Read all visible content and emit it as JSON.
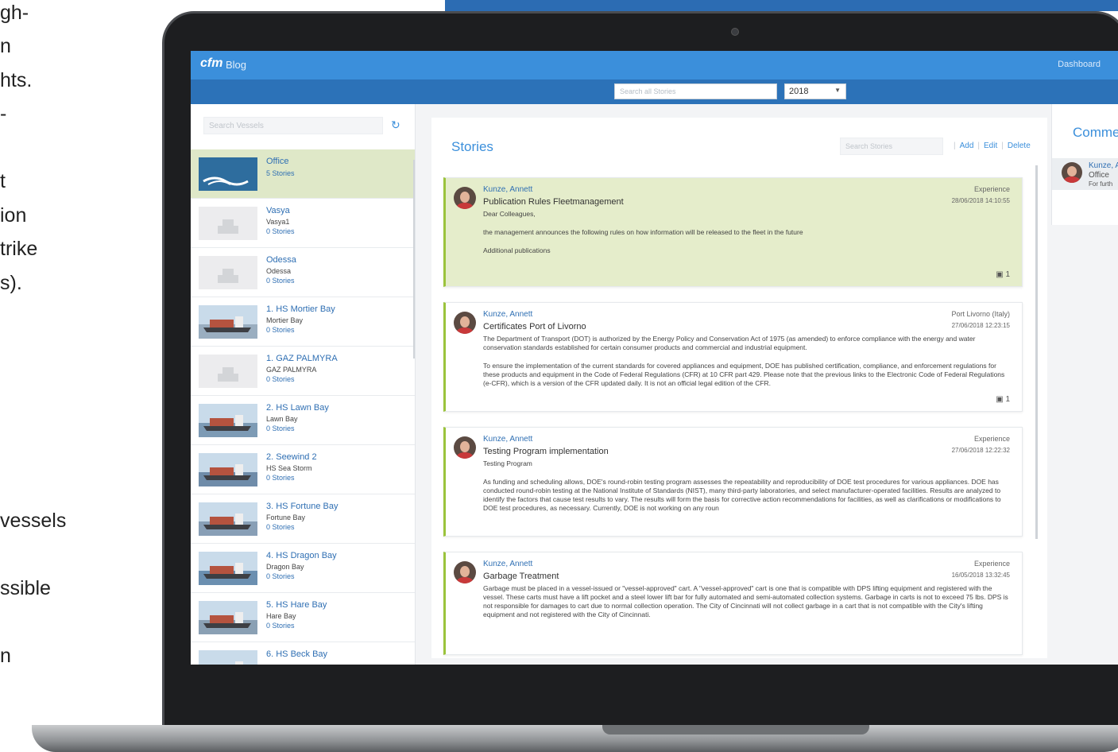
{
  "side_text": [
    "gh-",
    "n",
    "hts.",
    "-",
    "t",
    "ion",
    "trike",
    "s).",
    "vessels",
    "ssible",
    "n"
  ],
  "app": {
    "brand": "cfm",
    "brand_sub": "Blog",
    "nav_dashboard": "Dashboard",
    "global_search_placeholder": "Search all Stories",
    "year": "2018"
  },
  "vessels": {
    "search_placeholder": "Search Vessels",
    "items": [
      {
        "name": "Office",
        "sub": "",
        "count": "5 Stories",
        "thumb": "logo"
      },
      {
        "name": "Vasya",
        "sub": "Vasya1",
        "count": "0 Stories",
        "thumb": "placeholder"
      },
      {
        "name": "Odessa",
        "sub": "Odessa",
        "count": "0 Stories",
        "thumb": "placeholder"
      },
      {
        "name": "1. HS Mortier Bay",
        "sub": "Mortier Bay",
        "count": "0 Stories",
        "thumb": "ship"
      },
      {
        "name": "1. GAZ PALMYRA",
        "sub": "GAZ PALMYRA",
        "count": "0 Stories",
        "thumb": "placeholder"
      },
      {
        "name": "2. HS Lawn Bay",
        "sub": "Lawn Bay",
        "count": "0 Stories",
        "thumb": "ship"
      },
      {
        "name": "2. Seewind 2",
        "sub": "HS Sea Storm",
        "count": "0 Stories",
        "thumb": "ship"
      },
      {
        "name": "3. HS Fortune Bay",
        "sub": "Fortune Bay",
        "count": "0 Stories",
        "thumb": "ship"
      },
      {
        "name": "4. HS Dragon Bay",
        "sub": "Dragon Bay",
        "count": "0 Stories",
        "thumb": "ship"
      },
      {
        "name": "5. HS Hare Bay",
        "sub": "Hare Bay",
        "count": "0 Stories",
        "thumb": "ship"
      },
      {
        "name": "6. HS Beck Bay",
        "sub": "",
        "count": "",
        "thumb": "ship"
      }
    ]
  },
  "stories": {
    "title": "Stories",
    "search_placeholder": "Search Stories",
    "actions": {
      "add": "Add",
      "edit": "Edit",
      "delete": "Delete"
    },
    "cards": [
      {
        "author": "Kunze, Annett",
        "title": "Publication Rules Fleetmanagement",
        "category": "Experience",
        "date": "28/06/2018 14:10:55",
        "paragraphs": [
          "Dear Colleagues,",
          "the management announces the following rules on how information will be released to the fleet in the future",
          "Additional publications"
        ],
        "comments": "1"
      },
      {
        "author": "Kunze, Annett",
        "title": "Certificates Port of Livorno",
        "category": "Port Livorno (Italy)",
        "date": "27/06/2018 12:23:15",
        "paragraphs": [
          "The Department of Transport (DOT) is authorized by the Energy Policy and Conservation Act of 1975 (as amended) to enforce compliance with the energy and water conservation standards established for certain consumer products and commercial and industrial equipment.",
          "To ensure the implementation of the current standards for covered appliances and equipment, DOE has published certification, compliance, and enforcement regulations for these products and equipment in the Code of Federal Regulations (CFR) at 10 CFR part 429. Please note that the previous links to the Electronic Code of Federal Regulations (e-CFR), which is a version of the CFR updated daily. It is not an official legal edition of the CFR."
        ],
        "comments": "1"
      },
      {
        "author": "Kunze, Annett",
        "title": "Testing Program implementation",
        "category": "Experience",
        "date": "27/06/2018 12:22:32",
        "paragraphs": [
          "Testing Program",
          "As funding and scheduling allows, DOE's round-robin testing program assesses the repeatability and reproducibility of DOE test procedures for various appliances. DOE has conducted round-robin testing at the National Institute of Standards (NIST), many third-party laboratories, and select manufacturer-operated facilities. Results are analyzed to identify the factors that cause test results to vary. The results will form the basis for corrective action recommendations for facilities, as well as clarifications or modifications to DOE test procedures, as necessary. Currently, DOE is not working on any roun"
        ],
        "comments": ""
      },
      {
        "author": "Kunze, Annett",
        "title": "Garbage Treatment",
        "category": "Experience",
        "date": "16/05/2018 13:32:45",
        "paragraphs": [
          "Garbage must be placed in a vessel-issued or \"vessel-approved\" cart. A \"vessel-approved\" cart is one that is compatible with DPS lifting equipment and registered with the vessel. These carts must have a lift pocket and a steel lower lift bar for fully automated and semi-automated collection systems. Garbage in carts is not to exceed 75 lbs. DPS is not responsible for damages to cart due to normal collection operation. The City of Cincinnati will not collect garbage in a cart that is not compatible with the City's lifting equipment and not registered with the City of Cincinnati."
        ],
        "comments": ""
      }
    ]
  },
  "comments_panel": {
    "title": "Comme",
    "items": [
      {
        "name": "Kunze, A",
        "place": "Office",
        "text": "For furth"
      }
    ]
  },
  "colors": {
    "header": "#3b8fdb",
    "toolbar": "#2c72b8",
    "accent_green": "#9bc33c",
    "highlight": "#e5edcb"
  }
}
